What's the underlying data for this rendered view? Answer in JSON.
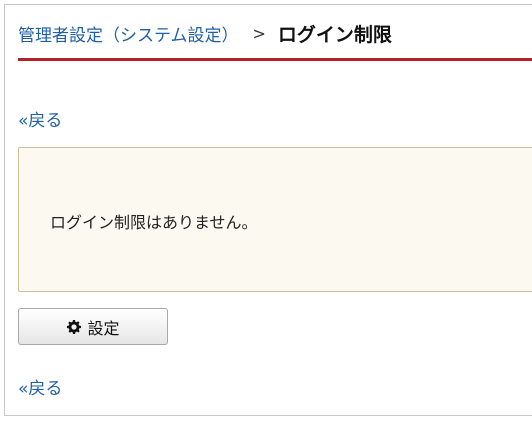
{
  "breadcrumb": {
    "parent_label": "管理者設定（システム設定）",
    "separator": ">",
    "current_label": "ログイン制限"
  },
  "navigation": {
    "back_top_label": "«戻る",
    "back_bottom_label": "«戻る"
  },
  "notice": {
    "message": "ログイン制限はありません。"
  },
  "actions": {
    "settings_button_label": "設定",
    "settings_button_icon": "gear-icon"
  },
  "colors": {
    "link": "#1f5fa8",
    "title_rule": "#b5202a",
    "notice_background": "#fcf9f1",
    "notice_border": "#cdbf9e"
  }
}
